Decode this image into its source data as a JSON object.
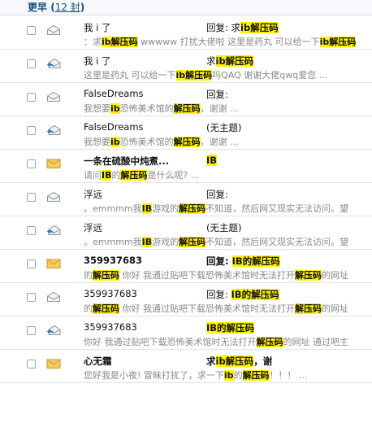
{
  "section": {
    "title": "更早",
    "count_link": "12 封"
  },
  "mail_rows": [
    {
      "icon": "envelope-open-icon",
      "unread": false,
      "sender": [
        {
          "t": "我 i 了"
        }
      ],
      "subject": [
        {
          "t": "回复: 求"
        },
        {
          "t": "ib解压码",
          "h": 1
        }
      ],
      "preview": [
        {
          "t": "：求"
        },
        {
          "t": "ib解压码",
          "h": 1
        },
        {
          "t": " wwwww 打扰大佬啦 这里是药丸 可以给一下"
        },
        {
          "t": "ib解压码",
          "h": 1
        }
      ]
    },
    {
      "icon": "envelope-replied-icon",
      "unread": false,
      "sender": [
        {
          "t": "我 i 了"
        }
      ],
      "subject": [
        {
          "t": "求"
        },
        {
          "t": "ib解压码",
          "h": 1
        }
      ],
      "preview": [
        {
          "t": "这里是药丸 可以给一下"
        },
        {
          "t": "ib解压码",
          "h": 1
        },
        {
          "t": "吗QAQ 谢谢大佬qwq爱您 ..."
        }
      ]
    },
    {
      "icon": "envelope-open-icon",
      "unread": false,
      "sender": [
        {
          "t": "FalseDreams"
        }
      ],
      "subject": [
        {
          "t": "回复:"
        }
      ],
      "preview": [
        {
          "t": "我想要"
        },
        {
          "t": "ib",
          "h": 1
        },
        {
          "t": "恐怖美术馆的"
        },
        {
          "t": "解压码",
          "h": 1
        },
        {
          "t": "，谢谢 ..."
        }
      ]
    },
    {
      "icon": "envelope-replied-icon",
      "unread": false,
      "sender": [
        {
          "t": "FalseDreams"
        }
      ],
      "subject": [
        {
          "t": "(无主题)"
        }
      ],
      "preview": [
        {
          "t": "我想要"
        },
        {
          "t": "ib",
          "h": 1
        },
        {
          "t": "恐怖美术馆的"
        },
        {
          "t": "解压码",
          "h": 1
        },
        {
          "t": "，谢谢 ..."
        }
      ]
    },
    {
      "icon": "envelope-unread-icon",
      "unread": true,
      "sender": [
        {
          "t": "一条在硫酸中炖煮..."
        }
      ],
      "subject": [
        {
          "t": "IB",
          "h": 1
        }
      ],
      "preview": [
        {
          "t": "请问"
        },
        {
          "t": "IB",
          "h": 1
        },
        {
          "t": "的"
        },
        {
          "t": "解压码",
          "h": 1
        },
        {
          "t": "是什么呢? ..."
        }
      ]
    },
    {
      "icon": "envelope-open-icon",
      "unread": false,
      "sender": [
        {
          "t": "浮远"
        }
      ],
      "subject": [
        {
          "t": "回复:"
        }
      ],
      "preview": [
        {
          "t": "。emmmm我"
        },
        {
          "t": "IB",
          "h": 1
        },
        {
          "t": "游戏的"
        },
        {
          "t": "解压码",
          "h": 1
        },
        {
          "t": "不知道，然后网又现实无法访问。望"
        }
      ]
    },
    {
      "icon": "envelope-replied-icon",
      "unread": false,
      "sender": [
        {
          "t": "浮远"
        }
      ],
      "subject": [
        {
          "t": "(无主题)"
        }
      ],
      "preview": [
        {
          "t": "。emmmm我"
        },
        {
          "t": "IB",
          "h": 1
        },
        {
          "t": "游戏的"
        },
        {
          "t": "解压码",
          "h": 1
        },
        {
          "t": "不知道，然后网又现实无法访问。望"
        }
      ]
    },
    {
      "icon": "envelope-unread-icon",
      "unread": true,
      "sender": [
        {
          "t": "359937683"
        }
      ],
      "subject": [
        {
          "t": "回复: "
        },
        {
          "t": "IB的解压码",
          "h": 1
        }
      ],
      "preview": [
        {
          "t": "的"
        },
        {
          "t": "解压码",
          "h": 1
        },
        {
          "t": " 你好 我通过贴吧下载恐怖美术馆时无法打开"
        },
        {
          "t": "解压码",
          "h": 1
        },
        {
          "t": "的网址"
        }
      ]
    },
    {
      "icon": "envelope-open-icon",
      "unread": false,
      "sender": [
        {
          "t": "359937683"
        }
      ],
      "subject": [
        {
          "t": "回复: "
        },
        {
          "t": "IB的解压码",
          "h": 1
        }
      ],
      "preview": [
        {
          "t": "的"
        },
        {
          "t": "解压码",
          "h": 1
        },
        {
          "t": " 你好 我通过贴吧下载恐怖美术馆时无法打开"
        },
        {
          "t": "解压码",
          "h": 1
        },
        {
          "t": "的网址"
        }
      ]
    },
    {
      "icon": "envelope-replied-icon",
      "unread": false,
      "sender": [
        {
          "t": "359937683"
        }
      ],
      "subject": [
        {
          "t": "IB的解压码",
          "h": 1
        }
      ],
      "preview": [
        {
          "t": "你好 我通过贴吧下载恐怖美术馆时无法打开"
        },
        {
          "t": "解压码",
          "h": 1
        },
        {
          "t": "的网址 通过吧主"
        }
      ]
    },
    {
      "icon": "envelope-unread-icon",
      "unread": true,
      "sender": [
        {
          "t": "心无霜"
        }
      ],
      "subject": [
        {
          "t": "求"
        },
        {
          "t": "ib解压码",
          "h": 1
        },
        {
          "t": "，谢"
        }
      ],
      "preview": [
        {
          "t": "您好我是小夜! 冒昧打扰了，求一下"
        },
        {
          "t": "ib",
          "h": 1
        },
        {
          "t": "的"
        },
        {
          "t": "解压码",
          "h": 1
        },
        {
          "t": "！！！ ..."
        }
      ]
    }
  ]
}
